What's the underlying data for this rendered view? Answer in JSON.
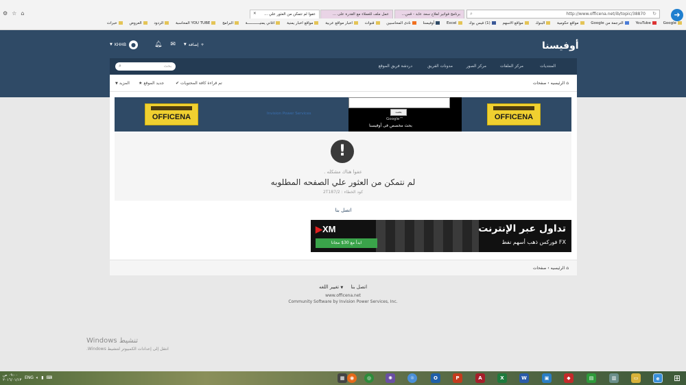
{
  "browser": {
    "url": "http://www.officena.net/ib/topic/38870",
    "tabs": [
      {
        "label": "عفوا لم تتمكن من العثور علي ...",
        "active": true
      },
      {
        "label": "عمل ملف للعملاء مع القدرة على ...",
        "active": false
      },
      {
        "label": "برنامج فواتير لفلاح سعد عابد - قس...",
        "active": false
      }
    ],
    "favorites": [
      "Google",
      "YouTube",
      "الترجمة من Google",
      "مواقع حكومية",
      "البنوك",
      "مواقع الاسهم",
      "(1) فيس بوك",
      "Excel",
      "أوفيسنا",
      "نادى المحاسبين",
      "قنوات",
      "اخبار مواقع عربية",
      "مواقع اخبار يمنية",
      "اغاني يمنيـــــــــــة",
      "البرامج",
      "YOU TUBE المحاسبة",
      "الردود",
      "العروض",
      "خبرات"
    ]
  },
  "site": {
    "logo": "أوفيسنا",
    "user": {
      "name": "KHHB",
      "add_label": "إضافة"
    },
    "nav": [
      "المنتديات",
      "مركز الملفات",
      "مركز الصور",
      "مدونات الفريق",
      "دردشة فريق الموقع"
    ],
    "search_placeholder": "بحث",
    "breadcrumb": {
      "home": "الرئيسيه",
      "current": "صفحات"
    },
    "actions": {
      "mark_read": "تم قراءة كافة المحتويات",
      "new": "جديد الموقع",
      "more": "المزيد"
    },
    "ad": {
      "brand": "OFFICENA",
      "ips_text": "Invision Power Services",
      "search_button": "بحث",
      "google_label": "Google™",
      "search_caption": "بحث مخصص فى أوفيسنا"
    },
    "error": {
      "line1": "عفوا هناك مشكله .",
      "line2": "لم نتمكن من العثور علي الصفحه المطلوبه",
      "code": "كود الخطاء : 2T187/2"
    },
    "contact": "اتصل بنا",
    "xm_ad": {
      "logo": "XM",
      "button": "ابدأ مع 30$ مجانا",
      "headline": "تداول عبر الإنترنت",
      "sub": "FX فوركس   ذهب   أسهم   نفط"
    },
    "footer": {
      "change_lang": "تغيير اللغه",
      "contact": "اتصل بنا",
      "domain": "www.officena.net",
      "powered": "Community Software by Invision Power Services, Inc."
    }
  },
  "windows": {
    "activation_title": "Windows تنشيط",
    "activation_text": "انتقل إلى إعدادات الكمبيوتر لتنشيط Windows.",
    "lang": "ENG",
    "time": "٠٩:٠٠ ص",
    "date": "٢٠١٦/٠١/١٣"
  }
}
